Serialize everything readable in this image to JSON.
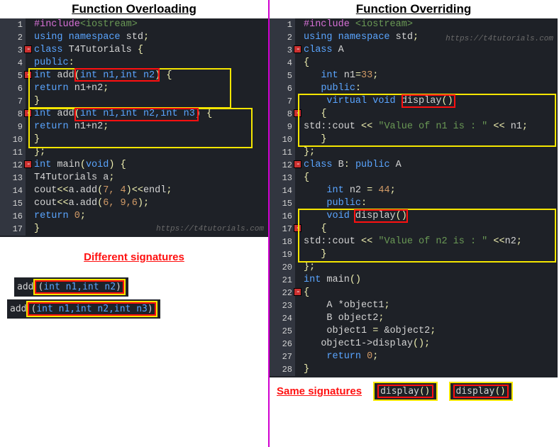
{
  "left": {
    "title": "Function Overloading",
    "watermark": "https://t4tutorials.com",
    "lines": {
      "l1_include": "#include",
      "l1_iostream": "<iostream>",
      "l2_using": "using",
      "l2_namespace": "namespace",
      "l2_std": "std",
      "l3_class": "class",
      "l3_name": "T4Tutorials",
      "l4_public": "public",
      "l5_int": "int",
      "l5_add": "add",
      "l5_params": "int n1,int n2",
      "l6_return": "return",
      "l6_expr": "n1+n2",
      "l8_int": "int",
      "l8_add": "add",
      "l8_params": "int n1,int n2,int n3",
      "l9_return": "return",
      "l9_expr": "n1+n2",
      "l12_int": "int",
      "l12_main": "main",
      "l12_void": "void",
      "l13_name": "T4Tutorials",
      "l13_a": "a",
      "l14_cout": "cout",
      "l14_add": "a.add",
      "l14_args": "7, 4",
      "l14_endl": "endl",
      "l15_cout": "cout",
      "l15_add": "a.add",
      "l15_args": "6, 9,6",
      "l16_return": "return",
      "l16_zero": "0"
    },
    "caption": "Different signatures",
    "sig1_fn": "add",
    "sig1_params": "int n1,int n2",
    "sig2_fn": "add",
    "sig2_params": "int n1,int n2,int n3"
  },
  "right": {
    "title": "Function Overriding",
    "watermark": "https://t4tutorials.com",
    "lines": {
      "l1_include": "#include",
      "l1_iostream": "<iostream>",
      "l2_using": "using",
      "l2_namespace": "namespace",
      "l2_std": "std",
      "l3_class": "class",
      "l3_name": "A",
      "l5_int": "int",
      "l5_n1": "n1",
      "l5_val": "33",
      "l6_public": "public",
      "l7_virtual": "virtual",
      "l7_void": "void",
      "l7_display": "display",
      "l9_stdcout": "std::cout",
      "l9_str": "\"Value of n1 is : \"",
      "l9_n1": "n1",
      "l12_class": "class",
      "l12_name": "B",
      "l12_public": "public",
      "l12_parent": "A",
      "l14_int": "int",
      "l14_n2": "n2",
      "l14_val": "44",
      "l15_public": "public",
      "l16_void": "void",
      "l16_display": "display",
      "l18_stdcout": "std::cout",
      "l18_str": "\"Value of n2 is : \"",
      "l18_n2": "n2",
      "l21_int": "int",
      "l21_main": "main",
      "l23_A": "A",
      "l23_obj1": "*object1",
      "l24_B": "B",
      "l24_obj2": "object2",
      "l25_obj1": "object1",
      "l25_obj2": "&object2",
      "l26_call": "object1->display",
      "l27_return": "return",
      "l27_zero": "0"
    },
    "caption": "Same signatures",
    "sig1": "display",
    "sig2": "display"
  }
}
